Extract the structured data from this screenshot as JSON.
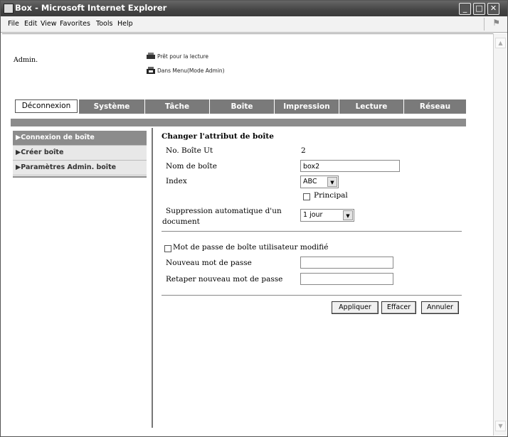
{
  "window": {
    "title": "Box - Microsoft Internet Explorer",
    "controls": [
      "_",
      "□",
      "✕"
    ]
  },
  "menu": [
    "File",
    "Edit",
    "View",
    "Favorites",
    "Tools",
    "Help"
  ],
  "status": {
    "ready": "Prêt pour la lecture",
    "mode": "Dans Menu(Mode Admin)"
  },
  "admin_label": "Admin.",
  "tabs": {
    "logout": "Déconnexion",
    "items": [
      "Système",
      "Tâche",
      "Boîte",
      "Impression",
      "Lecture",
      "Réseau"
    ]
  },
  "sidebar": {
    "items": [
      "▶Connexion de boîte",
      "▶Créer boîte",
      "▶Paramètres Admin. boîte"
    ]
  },
  "form": {
    "heading": "Changer l'attribut de boîte",
    "box_no_label": "No. Boîte Ut",
    "box_no_value": "2",
    "box_name_label": "Nom de boîte",
    "box_name_value": "box2",
    "index_label": "Index",
    "index_value": "ABC",
    "principal_label": "Principal",
    "auto_delete_label_1": "Suppression automatique d'un",
    "auto_delete_label_2": "document",
    "auto_delete_value": "1 jour",
    "pwd_changed_label": "Mot de passe de boîte utilisateur modifié",
    "new_pwd_label": "Nouveau mot de passe",
    "retype_pwd_label": "Retaper nouveau mot de passe"
  },
  "buttons": {
    "apply": "Appliquer",
    "clear": "Effacer",
    "cancel": "Annuler"
  }
}
